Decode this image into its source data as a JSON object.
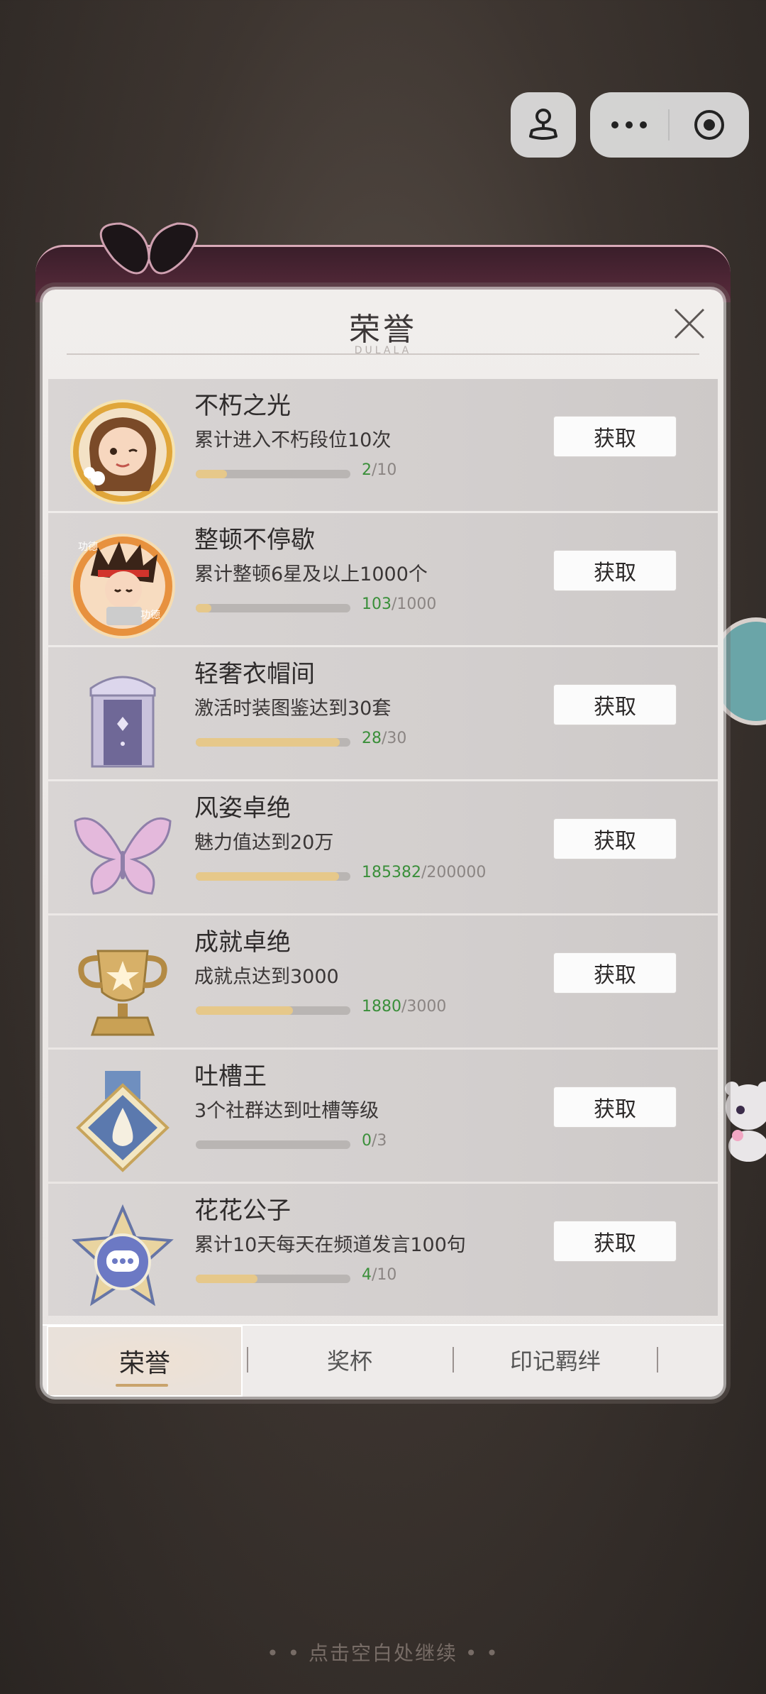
{
  "top_buttons": {
    "left_icon": "joystick-icon",
    "more_icon": "more-dots-icon",
    "close_icon": "target-circle-icon"
  },
  "panel": {
    "title": "荣誉",
    "subtitle": "DULALA",
    "close_icon": "close-x-icon"
  },
  "honors": [
    {
      "icon": "laurel-girl-avatar",
      "title": "不朽之光",
      "desc": "累计进入不朽段位10次",
      "current": "2",
      "total": "10",
      "fraction": 0.2,
      "button": "获取"
    },
    {
      "icon": "headband-boy-avatar",
      "title": "整顿不停歇",
      "desc": "累计整顿6星及以上1000个",
      "current": "103",
      "total": "1000",
      "fraction": 0.103,
      "button": "获取"
    },
    {
      "icon": "wardrobe-door-icon",
      "title": "轻奢衣帽间",
      "desc": "激活时装图鉴达到30套",
      "current": "28",
      "total": "30",
      "fraction": 0.933,
      "button": "获取"
    },
    {
      "icon": "butterfly-icon",
      "title": "风姿卓绝",
      "desc": "魅力值达到20万",
      "current": "185382",
      "total": "200000",
      "fraction": 0.927,
      "button": "获取"
    },
    {
      "icon": "gold-trophy-icon",
      "title": "成就卓绝",
      "desc": "成就点达到3000",
      "current": "1880",
      "total": "3000",
      "fraction": 0.627,
      "button": "获取"
    },
    {
      "icon": "blue-medal-icon",
      "title": "吐槽王",
      "desc": "3个社群达到吐槽等级",
      "current": "0",
      "total": "3",
      "fraction": 0.0,
      "button": "获取"
    },
    {
      "icon": "chat-star-icon",
      "title": "花花公子",
      "desc": "累计10天每天在频道发言100句",
      "current": "4",
      "total": "10",
      "fraction": 0.4,
      "button": "获取"
    }
  ],
  "tabs": [
    "荣誉",
    "奖杯",
    "印记羁绊"
  ],
  "hint": "• • 点击空白处继续 • •",
  "colors": {
    "progress_fill": "#e6c88a",
    "progress_current": "#3a8f3a",
    "tab_underline": "#c9a36c"
  }
}
